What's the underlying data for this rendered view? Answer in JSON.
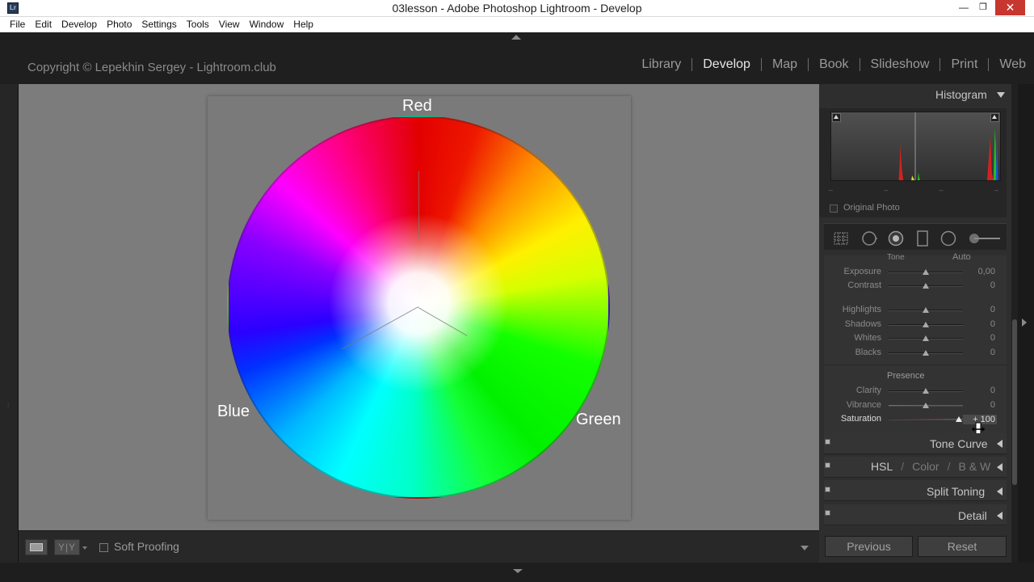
{
  "window": {
    "title": "03lesson - Adobe Photoshop Lightroom - Develop",
    "app_icon_text": "Lr",
    "minimize_glyph": "—",
    "maximize_glyph": "❐",
    "close_glyph": "✕"
  },
  "menubar": [
    "File",
    "Edit",
    "Develop",
    "Photo",
    "Settings",
    "Tools",
    "View",
    "Window",
    "Help"
  ],
  "identity_plate": "Copyright © Lepekhin Sergey - Lightroom.club",
  "modules": [
    {
      "label": "Library",
      "active": false
    },
    {
      "label": "Develop",
      "active": true
    },
    {
      "label": "Map",
      "active": false
    },
    {
      "label": "Book",
      "active": false
    },
    {
      "label": "Slideshow",
      "active": false
    },
    {
      "label": "Print",
      "active": false
    },
    {
      "label": "Web",
      "active": false
    }
  ],
  "image": {
    "labels": {
      "red": "Red",
      "green": "Green",
      "blue": "Blue"
    }
  },
  "toolbar": {
    "loupe_icon": "loupe-view-icon",
    "compare_glyph": "Y|Y",
    "soft_proofing_label": "Soft Proofing",
    "soft_proofing_checked": false
  },
  "histogram": {
    "title": "Histogram",
    "original_photo_label": "Original Photo",
    "original_photo_checked": false,
    "info_placeholders": [
      "–",
      "–",
      "–",
      "–"
    ]
  },
  "basic": {
    "tone_label": "Tone",
    "auto_label": "Auto",
    "presence_label": "Presence",
    "sliders_tone": [
      {
        "name": "exposure",
        "label": "Exposure",
        "value": "0,00",
        "position": 0.5
      },
      {
        "name": "contrast",
        "label": "Contrast",
        "value": "0",
        "position": 0.5
      }
    ],
    "sliders_tone2": [
      {
        "name": "highlights",
        "label": "Highlights",
        "value": "0",
        "position": 0.5
      },
      {
        "name": "shadows",
        "label": "Shadows",
        "value": "0",
        "position": 0.5
      },
      {
        "name": "whites",
        "label": "Whites",
        "value": "0",
        "position": 0.5
      },
      {
        "name": "blacks",
        "label": "Blacks",
        "value": "0",
        "position": 0.5
      }
    ],
    "sliders_presence": [
      {
        "name": "clarity",
        "label": "Clarity",
        "value": "0",
        "position": 0.5
      },
      {
        "name": "vibrance",
        "label": "Vibrance",
        "value": "0",
        "position": 0.5
      }
    ],
    "saturation": {
      "label": "Saturation",
      "value": "+ 100",
      "position": 0.95
    }
  },
  "panels": {
    "tone_curve": "Tone Curve",
    "hsl": {
      "hsl": "HSL",
      "sep": "/",
      "color": "Color",
      "bw": "B & W"
    },
    "split_toning": "Split Toning",
    "detail": "Detail"
  },
  "buttons": {
    "previous": "Previous",
    "reset": "Reset"
  }
}
